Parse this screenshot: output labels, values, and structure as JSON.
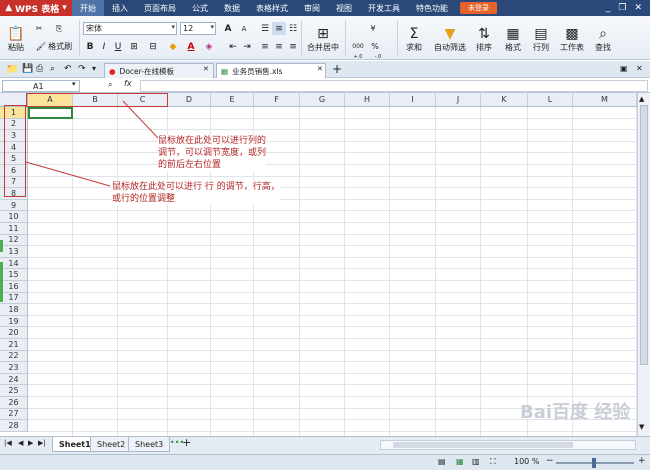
{
  "menubar": {
    "app_name": "WPS 表格",
    "tabs": [
      "开始",
      "插入",
      "页面布局",
      "公式",
      "数据",
      "表格样式",
      "审阅",
      "视图",
      "开发工具",
      "特色功能"
    ],
    "login": "未登录",
    "window_controls": [
      "minimize-icon",
      "restore-icon",
      "close-icon"
    ]
  },
  "ribbon": {
    "paste": "粘贴",
    "format_painter": "格式刷",
    "font_name": "宋体",
    "font_size": "12",
    "merge_center": "合并居中",
    "sum": "求和",
    "autofilter": "自动筛选",
    "sort": "排序",
    "format": "格式",
    "row_col": "行列",
    "worksheet": "工作表",
    "find": "查找",
    "bold": "B",
    "italic": "I",
    "underline": "U",
    "font_color": "A",
    "grow_font": "A",
    "shrink_font": "A",
    "percent": "%",
    "thousands": "000",
    "inc_decimal": "+.0",
    "dec_decimal": "-.0"
  },
  "doc_tabs": [
    {
      "label": "Docer-在线模板",
      "active": false
    },
    {
      "label": "业务员销售.xls",
      "active": true
    }
  ],
  "formula_bar": {
    "name_box": "A1",
    "fx": "fx"
  },
  "columns": [
    "A",
    "B",
    "C",
    "D",
    "E",
    "F",
    "G",
    "H",
    "I",
    "J",
    "K",
    "L",
    "M"
  ],
  "rows": [
    "1",
    "2",
    "3",
    "4",
    "5",
    "6",
    "7",
    "8",
    "9",
    "10",
    "11",
    "12",
    "13",
    "14",
    "15",
    "16",
    "17",
    "18",
    "19",
    "20",
    "21",
    "22",
    "23",
    "24",
    "25",
    "26",
    "27",
    "28"
  ],
  "annotations": {
    "column_note": [
      "鼠标放在此处可以进行列的",
      "调节，可以调节宽度，或列",
      "的前后左右位置"
    ],
    "row_note": [
      "鼠标放在此处可以进行 行 的调节，行高，",
      "或行的位置调整"
    ]
  },
  "sheets": [
    "Sheet1",
    "Sheet2",
    "Sheet3"
  ],
  "status": {
    "zoom": "100 %"
  },
  "watermark": "Bai百度 经验"
}
